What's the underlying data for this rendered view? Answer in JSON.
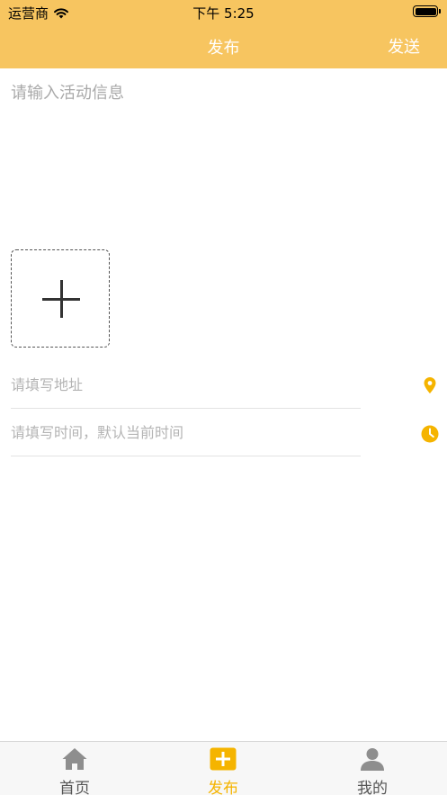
{
  "status_bar": {
    "carrier": "运营商",
    "time": "下午 5:25"
  },
  "nav": {
    "title": "发布",
    "send_label": "发送"
  },
  "form": {
    "content_placeholder": "请输入活动信息",
    "address_placeholder": "请填写地址",
    "time_placeholder": "请填写时间，默认当前时间"
  },
  "tabbar": {
    "tabs": [
      {
        "label": "首页",
        "icon": "home-icon",
        "active": false
      },
      {
        "label": "发布",
        "icon": "add-box-icon",
        "active": true
      },
      {
        "label": "我的",
        "icon": "user-icon",
        "active": false
      }
    ]
  },
  "colors": {
    "accent": "#f7c560",
    "icon_active": "#f5b400",
    "tab_inactive": "#555555",
    "tab_icon_inactive": "#8e8e8e"
  }
}
